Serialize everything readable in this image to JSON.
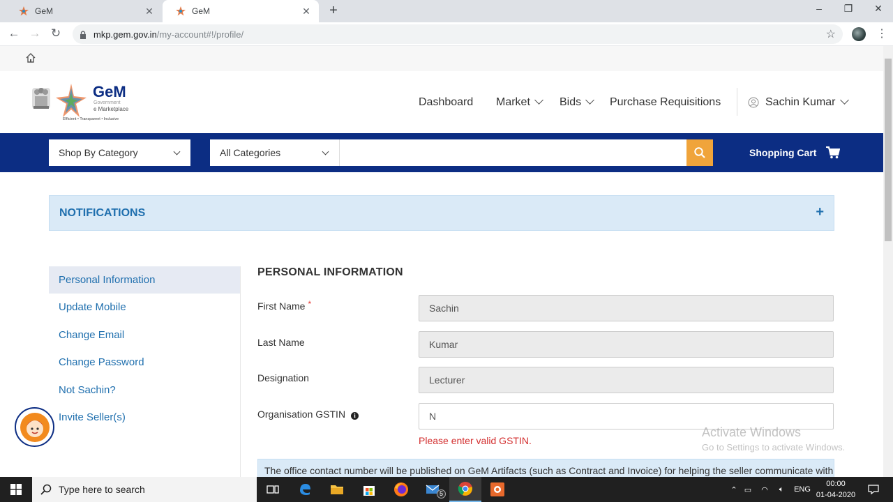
{
  "browser": {
    "tabs": [
      {
        "title": "GeM"
      },
      {
        "title": "GeM"
      }
    ],
    "url_host": "mkp.gem.gov.in",
    "url_path": "/my-account#!/profile/"
  },
  "header": {
    "logo_text": "GeM",
    "logo_sub1": "Government",
    "logo_sub2": "e Marketplace",
    "logo_tagline": "Efficient • Transparent • Inclusive",
    "nav": {
      "dashboard": "Dashboard",
      "market": "Market",
      "bids": "Bids",
      "purchase_requisitions": "Purchase Requisitions",
      "user": "Sachin Kumar"
    }
  },
  "searchbar": {
    "shop_by_category": "Shop By Category",
    "all_categories": "All Categories",
    "search_placeholder": "",
    "cart_label": "Shopping Cart"
  },
  "notifications": {
    "title": "NOTIFICATIONS",
    "toggle": "+"
  },
  "sidebar": {
    "items": [
      {
        "label": "Personal Information"
      },
      {
        "label": "Update Mobile"
      },
      {
        "label": "Change Email"
      },
      {
        "label": "Change Password"
      },
      {
        "label": "Not Sachin?"
      },
      {
        "label": "Invite Seller(s)"
      }
    ]
  },
  "form": {
    "title": "PERSONAL INFORMATION",
    "required_mark": "*",
    "first_name": {
      "label": "First Name",
      "value": "Sachin"
    },
    "last_name": {
      "label": "Last Name",
      "value": "Kumar"
    },
    "designation": {
      "label": "Designation",
      "value": "Lecturer"
    },
    "gstin": {
      "label": "Organisation GSTIN",
      "value": "N",
      "error": "Please enter valid GSTIN."
    },
    "notice": "The office contact number will be published on GeM Artifacts (such as Contract and Invoice) for helping the seller communicate with"
  },
  "watermark": {
    "line1": "Activate Windows",
    "line2": "Go to Settings to activate Windows."
  },
  "taskbar": {
    "search_placeholder": "Type here to search",
    "mail_badge": "5",
    "lang": "ENG",
    "time": "00:00",
    "date": "01-04-2020"
  },
  "colors": {
    "brand_blue": "#0c2d83",
    "search_button": "#f0a43b",
    "link_blue": "#1f6fae",
    "error_red": "#d32f2f"
  }
}
